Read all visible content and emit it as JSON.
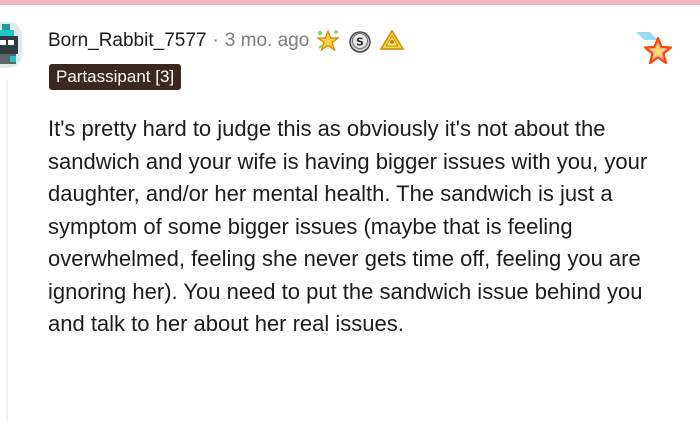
{
  "comment": {
    "username": "Born_Rabbit_7577",
    "separator": "·",
    "timestamp": "3 mo. ago",
    "flair": "Partassipant [3]",
    "body": "It's pretty hard to judge this as obviously it's not about the sandwich and your wife is having bigger issues with you, your daughter, and/or her mental health. The sandwich is just a symptom of some bigger issues (maybe that is feeling overwhelmed, feeling she never gets time off, feeling you are ignoring her). You need to put the sandwich issue behind you and talk to her about her real issues.",
    "awards": [
      "star-burst-icon",
      "silver-coin-icon",
      "gold-pyramid-icon"
    ],
    "corner_award": "star-award-icon"
  },
  "colors": {
    "top_strip": "#f2b6bf",
    "flair_bg": "#3d2820",
    "meta_text": "#7c7c7c",
    "body_text": "#1c1c1c"
  }
}
